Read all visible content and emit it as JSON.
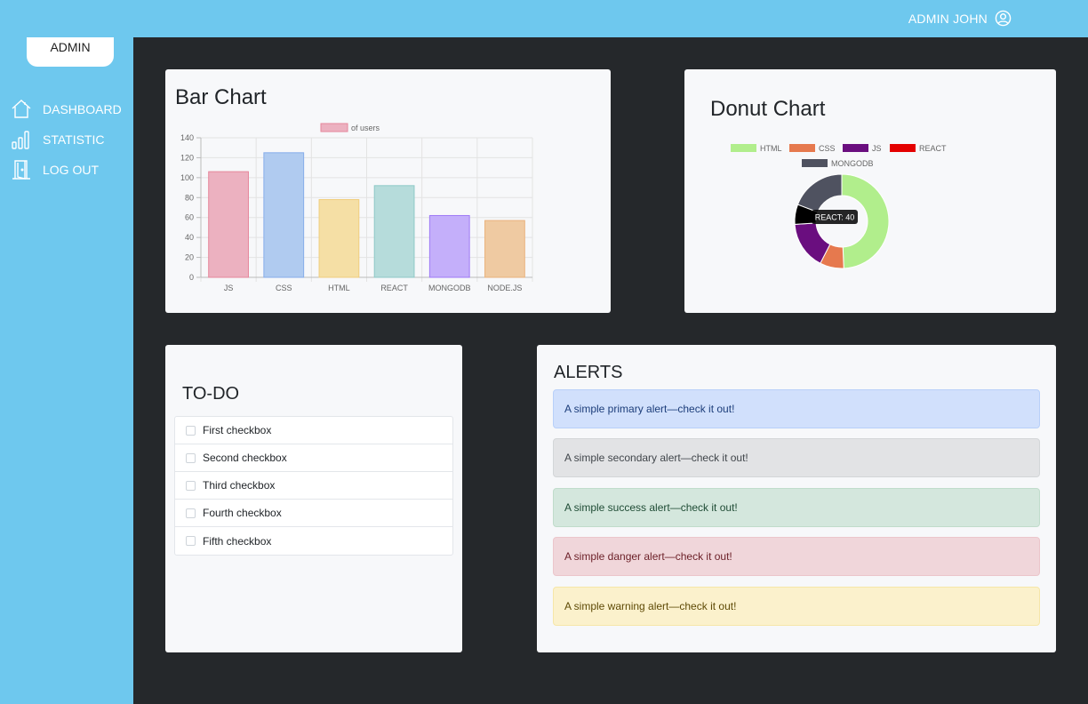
{
  "topbar": {
    "user_name": "ADMIN JOHN"
  },
  "sidebar": {
    "brand": "ADMIN",
    "items": [
      {
        "label": "DASHBOARD",
        "icon": "home-icon"
      },
      {
        "label": "STATISTIC",
        "icon": "stats-icon"
      },
      {
        "label": "LOG OUT",
        "icon": "door-icon"
      }
    ]
  },
  "bar_card": {
    "title": "Bar Chart"
  },
  "donut_card": {
    "title": "Donut Chart",
    "tooltip": "REACT: 40"
  },
  "todo": {
    "title": "TO-DO",
    "items": [
      "First checkbox",
      "Second checkbox",
      "Third checkbox",
      "Fourth checkbox",
      "Fifth checkbox"
    ]
  },
  "alerts": {
    "title": "ALERTS",
    "items": [
      "A simple primary alert—check it out!",
      "A simple secondary alert—check it out!",
      "A simple success alert—check it out!",
      "A simple danger alert—check it out!",
      "A simple warning alert—check it out!"
    ]
  },
  "chart_data": [
    {
      "type": "bar",
      "title": "Bar Chart",
      "categories": [
        "JS",
        "CSS",
        "HTML",
        "REACT",
        "MONGODB",
        "NODE.JS"
      ],
      "series": [
        {
          "name": "of users",
          "values": [
            106,
            125,
            78,
            92,
            62,
            57
          ]
        }
      ],
      "ylim": [
        0,
        140
      ],
      "yticks": [
        0,
        20,
        40,
        60,
        80,
        100,
        120,
        140
      ],
      "grid": true,
      "legend": "top",
      "colors": {
        "fill": [
          "#ecb1c0",
          "#b0cbf0",
          "#f5dfa5",
          "#b6dcdb",
          "#c4affa",
          "#efcaa2"
        ],
        "stroke": [
          "#e6869b",
          "#86adea",
          "#f0cd7d",
          "#8ec9c7",
          "#9e7af6",
          "#e9b27c"
        ],
        "legend": "#ecb1c0"
      }
    },
    {
      "type": "pie",
      "title": "Donut Chart",
      "categories": [
        "HTML",
        "CSS",
        "JS",
        "REACT",
        "MONGODB"
      ],
      "values": [
        180,
        30,
        60,
        25,
        70
      ],
      "legend": "top",
      "colors": {
        "HTML": "#b1ee8c",
        "CSS": "#e6794e",
        "JS": "#6a0e7f",
        "REACT": "#e40000",
        "MONGODB": "#4f5260"
      },
      "highlighted_color": "#000000"
    }
  ]
}
